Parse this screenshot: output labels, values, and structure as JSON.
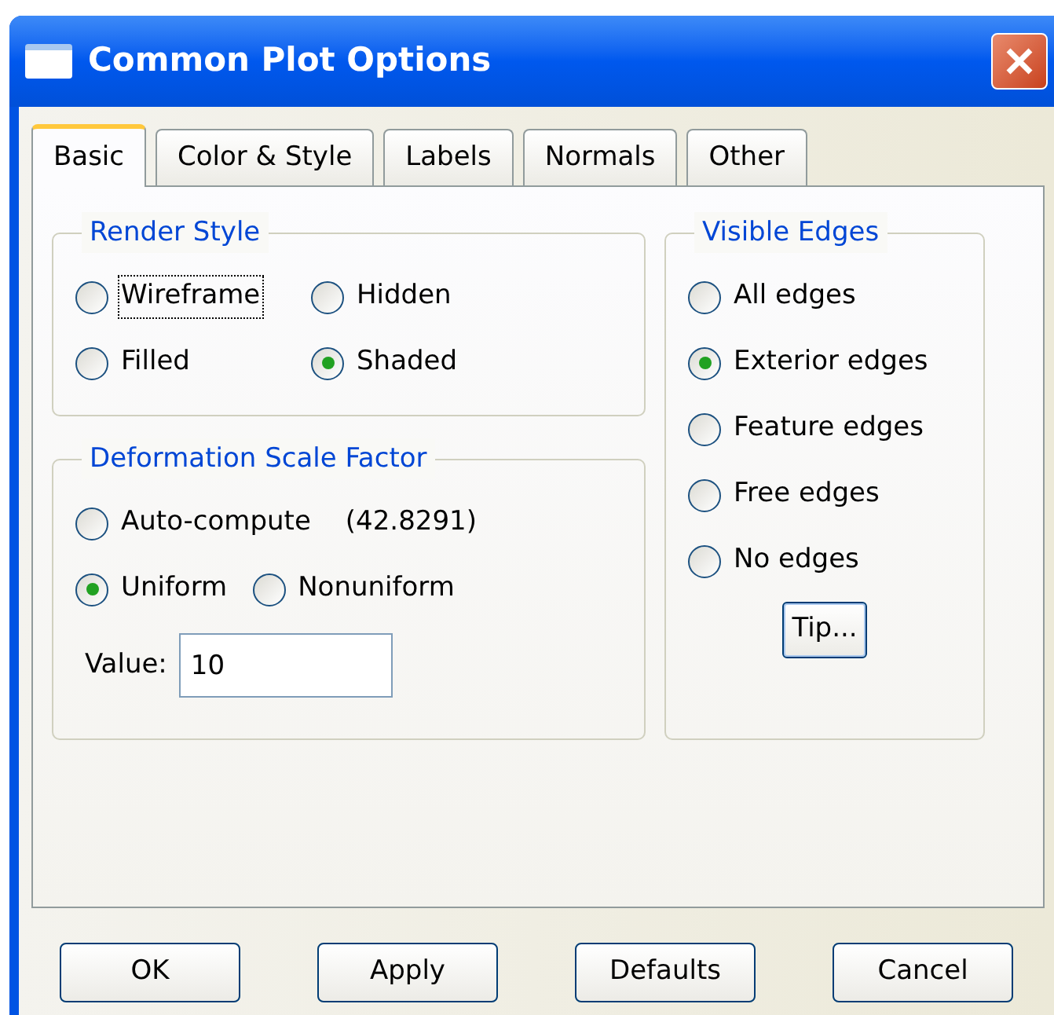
{
  "window": {
    "title": "Common Plot Options"
  },
  "tabs": [
    {
      "label": "Basic",
      "selected": true
    },
    {
      "label": "Color & Style",
      "selected": false
    },
    {
      "label": "Labels",
      "selected": false
    },
    {
      "label": "Normals",
      "selected": false
    },
    {
      "label": "Other",
      "selected": false
    }
  ],
  "render_style": {
    "title": "Render Style",
    "options": [
      {
        "label": "Wireframe",
        "selected": false,
        "focused": true
      },
      {
        "label": "Hidden",
        "selected": false,
        "focused": false
      },
      {
        "label": "Filled",
        "selected": false,
        "focused": false
      },
      {
        "label": "Shaded",
        "selected": true,
        "focused": false
      }
    ]
  },
  "deformation_scale_factor": {
    "title": "Deformation Scale Factor",
    "options": [
      {
        "label": "Auto-compute",
        "note": "(42.8291)",
        "selected": false
      },
      {
        "label": "Uniform",
        "selected": true
      },
      {
        "label": "Nonuniform",
        "selected": false
      }
    ],
    "value_field": {
      "label": "Value:",
      "value": "10"
    }
  },
  "visible_edges": {
    "title": "Visible Edges",
    "options": [
      {
        "label": "All edges",
        "selected": false
      },
      {
        "label": "Exterior edges",
        "selected": true
      },
      {
        "label": "Feature edges",
        "selected": false
      },
      {
        "label": "Free edges",
        "selected": false
      },
      {
        "label": "No edges",
        "selected": false
      }
    ],
    "tip_button": "Tip..."
  },
  "buttons": [
    "OK",
    "Apply",
    "Defaults",
    "Cancel"
  ]
}
